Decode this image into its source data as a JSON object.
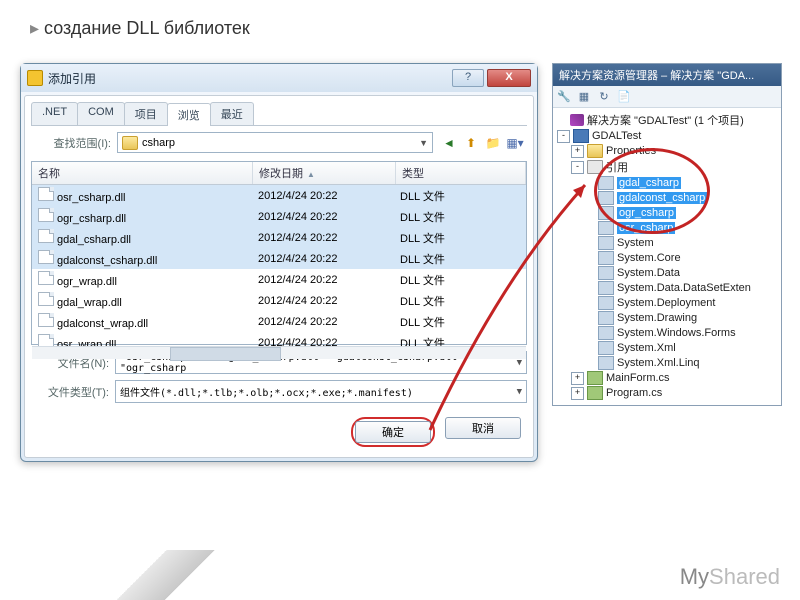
{
  "slide": {
    "title": "создание DLL библиотек"
  },
  "watermark": {
    "prefix": "My",
    "suffix": "Shared"
  },
  "dialog": {
    "title": "添加引用",
    "help": "?",
    "close": "X",
    "tabs": [
      ".NET",
      "COM",
      "项目",
      "浏览",
      "最近"
    ],
    "active_tab": 3,
    "lookin_label": "查找范围(I):",
    "lookin_value": "csharp",
    "columns": {
      "name": "名称",
      "date": "修改日期",
      "type": "类型"
    },
    "files": [
      {
        "name": "osr_csharp.dll",
        "date": "2012/4/24 20:22",
        "type": "DLL 文件",
        "sel": true
      },
      {
        "name": "ogr_csharp.dll",
        "date": "2012/4/24 20:22",
        "type": "DLL 文件",
        "sel": true
      },
      {
        "name": "gdal_csharp.dll",
        "date": "2012/4/24 20:22",
        "type": "DLL 文件",
        "sel": true
      },
      {
        "name": "gdalconst_csharp.dll",
        "date": "2012/4/24 20:22",
        "type": "DLL 文件",
        "sel": true
      },
      {
        "name": "ogr_wrap.dll",
        "date": "2012/4/24 20:22",
        "type": "DLL 文件",
        "sel": false
      },
      {
        "name": "gdal_wrap.dll",
        "date": "2012/4/24 20:22",
        "type": "DLL 文件",
        "sel": false
      },
      {
        "name": "gdalconst_wrap.dll",
        "date": "2012/4/24 20:22",
        "type": "DLL 文件",
        "sel": false
      },
      {
        "name": "osr_wrap.dll",
        "date": "2012/4/24 20:22",
        "type": "DLL 文件",
        "sel": false
      }
    ],
    "filename_label": "文件名(N):",
    "filename_value": "\"osr_csharp.dll\" \"gdal_csharp.dll\" \"gdalconst_csharp.dll\" \"ogr_csharp",
    "filetype_label": "文件类型(T):",
    "filetype_value": "组件文件(*.dll;*.tlb;*.olb;*.ocx;*.exe;*.manifest)",
    "ok": "确定",
    "cancel": "取消"
  },
  "se": {
    "title": "解决方案资源管理器 – 解决方案 \"GDA...",
    "solution": "解决方案 \"GDALTest\" (1 个项目)",
    "project": "GDALTest",
    "props": "Properties",
    "refs": "引用",
    "ref_items": [
      "gdal_csharp",
      "gdalconst_csharp",
      "ogr_csharp",
      "osr_csharp",
      "System",
      "System.Core",
      "System.Data",
      "System.Data.DataSetExten",
      "System.Deployment",
      "System.Drawing",
      "System.Windows.Forms",
      "System.Xml",
      "System.Xml.Linq"
    ],
    "files": [
      "MainForm.cs",
      "Program.cs"
    ]
  }
}
